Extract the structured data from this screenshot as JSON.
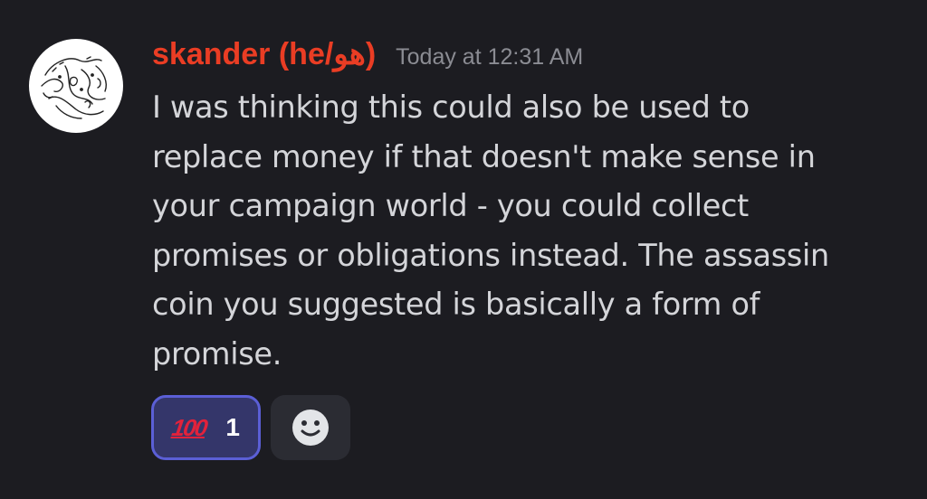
{
  "message": {
    "author": "skander (he/هو)",
    "timestamp": "Today at 12:31 AM",
    "content_lines": [
      "I was thinking this could also be used to",
      "replace money if that doesn't make sense in",
      "your campaign world - you could collect",
      "promises or obligations instead. The assassin",
      "coin you suggested is basically a form of",
      "promise."
    ],
    "author_color": "#ea3d24",
    "avatar_icon": "calligraphy-avatar-icon"
  },
  "reactions": [
    {
      "emoji": "💯",
      "emoji_text": "100",
      "count": "1",
      "active": true
    }
  ],
  "add_reaction": {
    "icon": "smiley-face-icon"
  },
  "colors": {
    "background": "#1c1c21",
    "text": "#d4d5d9",
    "muted": "#8b8c93",
    "reaction_active_bg": "#34366a",
    "reaction_active_border": "#5b5fd6",
    "button_bg": "#2b2c33"
  }
}
